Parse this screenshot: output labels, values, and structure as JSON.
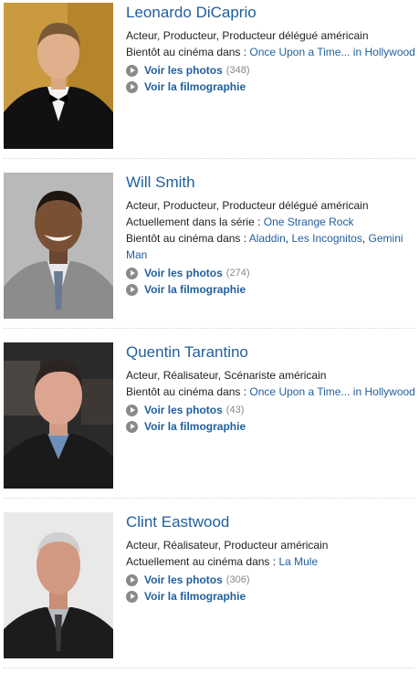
{
  "labels": {
    "photos": "Voir les photos",
    "filmography": "Voir la filmographie",
    "upcoming": "Bientôt au cinéma dans : ",
    "in_series": "Actuellement dans la série : ",
    "in_cinema": "Actuellement au cinéma dans : "
  },
  "people": [
    {
      "name": "Leonardo DiCaprio",
      "roles": "Acteur, Producteur, Producteur délégué américain",
      "upcoming_film": "Once Upon a Time... in Hollywood",
      "photos_count": "(348)"
    },
    {
      "name": "Will Smith",
      "roles": "Acteur, Producteur, Producteur délégué américain",
      "series": "One Strange Rock",
      "upcoming_films": [
        "Aladdin",
        "Les Incognitos",
        "Gemini Man"
      ],
      "photos_count": "(274)"
    },
    {
      "name": "Quentin Tarantino",
      "roles": "Acteur, Réalisateur, Scénariste américain",
      "upcoming_film": "Once Upon a Time... in Hollywood",
      "photos_count": "(43)"
    },
    {
      "name": "Clint Eastwood",
      "roles": "Acteur, Réalisateur, Producteur américain",
      "current_film": "La Mule",
      "photos_count": "(306)"
    }
  ],
  "colors": {
    "link": "#1f5f9e",
    "text": "#222222",
    "count": "#888888",
    "icon": "#8a8a8a"
  }
}
